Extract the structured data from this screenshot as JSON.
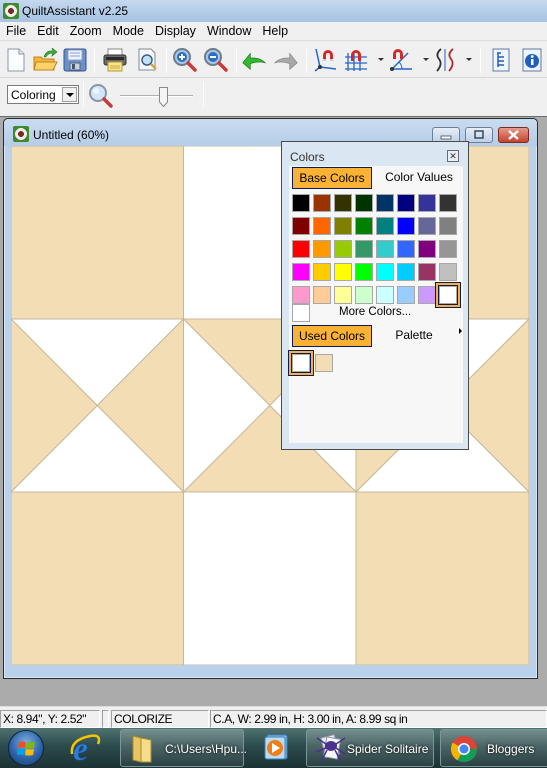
{
  "app": {
    "title": "QuiltAssistant v2.25"
  },
  "menubar": {
    "items": [
      "File",
      "Edit",
      "Zoom",
      "Mode",
      "Display",
      "Window",
      "Help"
    ]
  },
  "toolbar1": {
    "buttons": [
      {
        "name": "new-document",
        "icon": "new-document-icon"
      },
      {
        "name": "open",
        "icon": "open-folder-icon"
      },
      {
        "name": "save",
        "icon": "floppy-disk-icon"
      },
      {
        "name": "print",
        "icon": "printer-icon"
      },
      {
        "name": "print-preview",
        "icon": "print-preview-icon"
      },
      {
        "name": "zoom-in",
        "icon": "zoom-in-icon"
      },
      {
        "name": "zoom-out",
        "icon": "zoom-out-icon"
      },
      {
        "name": "undo",
        "icon": "undo-arrow-icon"
      },
      {
        "name": "redo",
        "icon": "redo-arrow-icon",
        "disabled": true
      },
      {
        "name": "snap-to-intersection",
        "icon": "magnet-intersection-icon"
      },
      {
        "name": "snap-to-grid",
        "icon": "magnet-grid-icon",
        "has_dropdown": true
      },
      {
        "name": "snap-to-angle",
        "icon": "magnet-angle-icon",
        "has_dropdown": true
      },
      {
        "name": "curve-tool",
        "icon": "curve-line-icon",
        "has_dropdown": true
      },
      {
        "name": "outline",
        "icon": "outline-document-icon"
      },
      {
        "name": "info",
        "icon": "info-icon"
      }
    ]
  },
  "toolbar2": {
    "mode_select": {
      "value": "Coloring"
    },
    "zoom_icon": "magnifier-icon",
    "zoom_slider": {
      "value_percent": 60
    }
  },
  "child_window": {
    "title": "Untitled (60%)"
  },
  "quilt": {
    "colors": {
      "tan": "#f3ddb4",
      "white": "#ffffff",
      "seam": "#c8b89a"
    },
    "blocks": [
      {
        "row": 0,
        "col": 0,
        "type": "solid",
        "fill": "tan"
      },
      {
        "row": 0,
        "col": 1,
        "type": "solid",
        "fill": "white"
      },
      {
        "row": 0,
        "col": 2,
        "type": "solid",
        "fill": "tan"
      },
      {
        "row": 1,
        "col": 0,
        "type": "hourglass",
        "top": "white",
        "right": "tan",
        "bottom": "white",
        "left": "tan"
      },
      {
        "row": 1,
        "col": 1,
        "type": "hourglass",
        "top": "tan",
        "right": "white",
        "bottom": "tan",
        "left": "white"
      },
      {
        "row": 1,
        "col": 2,
        "type": "hourglass",
        "top": "white",
        "right": "tan",
        "bottom": "white",
        "left": "tan"
      },
      {
        "row": 2,
        "col": 0,
        "type": "solid",
        "fill": "tan"
      },
      {
        "row": 2,
        "col": 1,
        "type": "solid",
        "fill": "white"
      },
      {
        "row": 2,
        "col": 2,
        "type": "solid",
        "fill": "tan"
      }
    ]
  },
  "colors_panel": {
    "title": "Colors",
    "tabs": {
      "base": "Base Colors",
      "values": "Color Values"
    },
    "base_colors": [
      "#000000",
      "#993300",
      "#333300",
      "#003300",
      "#003366",
      "#000080",
      "#333399",
      "#333333",
      "#800000",
      "#ff6600",
      "#808000",
      "#008000",
      "#008080",
      "#0000ff",
      "#666699",
      "#808080",
      "#ff0000",
      "#ff9900",
      "#99cc00",
      "#339966",
      "#33cccc",
      "#3366ff",
      "#800080",
      "#969696",
      "#ff00ff",
      "#ffcc00",
      "#ffff00",
      "#00ff00",
      "#00ffff",
      "#00ccff",
      "#993366",
      "#c0c0c0",
      "#ff99cc",
      "#ffcc99",
      "#ffff99",
      "#ccffcc",
      "#ccffff",
      "#99ccff",
      "#cc99ff",
      "#ffffff"
    ],
    "selected_base_index": 39,
    "more_colors_label": "More Colors...",
    "used_tabs": {
      "used": "Used Colors",
      "palette": "Palette"
    },
    "used_colors": [
      "#ffffff",
      "#f3ddb4"
    ],
    "selected_used_index": 0,
    "accent": "#f9b233"
  },
  "statusbar": {
    "coords": "X: 8.94\", Y: 2.52\"",
    "blank": "",
    "mode": "COLORIZE",
    "info": "C.A, W: 2.99 in, H: 3.00 in, A: 8.99 sq in"
  },
  "taskbar": {
    "items": [
      {
        "name": "start",
        "icon": "windows-start-icon"
      },
      {
        "name": "internet-explorer",
        "icon": "internet-explorer-icon"
      },
      {
        "name": "explorer",
        "icon": "folder-icon",
        "label": "C:\\Users\\Hpu..."
      },
      {
        "name": "media-player",
        "icon": "media-player-icon"
      },
      {
        "name": "spider-solitaire",
        "icon": "spider-solitaire-icon",
        "label": "Spider Solitaire"
      },
      {
        "name": "chrome",
        "icon": "chrome-icon",
        "label": "Bloggers"
      }
    ]
  }
}
